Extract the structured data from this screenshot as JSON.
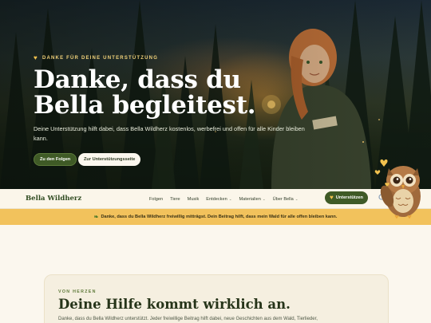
{
  "hero": {
    "eyebrow": "DANKE FÜR DEINE UNTERSTÜTZUNG",
    "eyebrow_icon": "yellow-heart-icon",
    "title": "Danke, dass du Bella begleitest.",
    "text": "Deine Unterstützung hilft dabei, dass Bella Wildherz kostenlos, werbefrei und offen für alle Kinder bleiben kann.",
    "primary_button": "Zu den Folgen",
    "secondary_button": "Zur Unterstützungsseite"
  },
  "nav": {
    "brand": "Bella Wildherz",
    "items": [
      {
        "label": "Folgen",
        "dropdown": false
      },
      {
        "label": "Tiere",
        "dropdown": false
      },
      {
        "label": "Musik",
        "dropdown": false
      },
      {
        "label": "Entdecken",
        "dropdown": true
      },
      {
        "label": "Materialien",
        "dropdown": true
      },
      {
        "label": "Über Bella",
        "dropdown": true
      }
    ],
    "support_button": "Unterstützen",
    "support_icon": "yellow-heart-icon"
  },
  "banner": {
    "icon": "leaf-icon",
    "text": "Danke, dass du Bella Wildherz freiwillig mitträgst. Dein Beitrag hilft, dass mein Wald für alle offen bleiben kann."
  },
  "card": {
    "eyebrow": "VON HERZEN",
    "title": "Deine Hilfe kommt wirklich an.",
    "text": "Danke, dass du Bella Wildherz unterstützt. Jeder freiwillige Beitrag hilft dabei, neue Geschichten aus dem Wald, Tierlieder,"
  },
  "colors": {
    "brand_green": "#3f5a26",
    "banner_yellow": "#f2c25c",
    "heart_yellow": "#f2c14e"
  }
}
